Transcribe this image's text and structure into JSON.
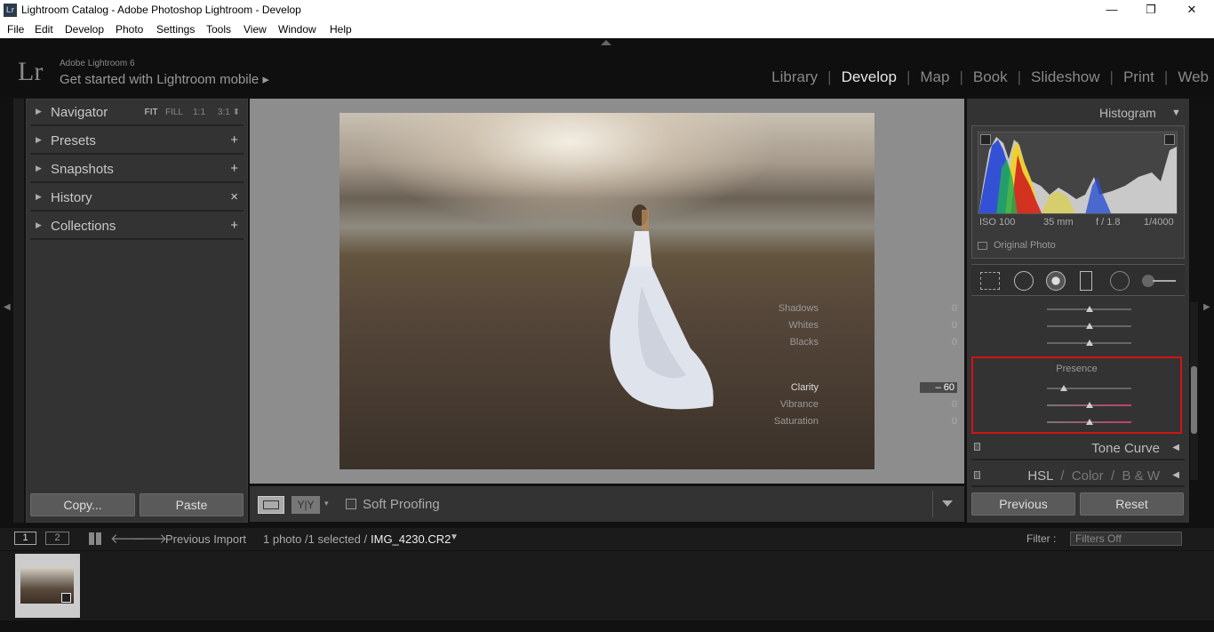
{
  "titlebar": {
    "title": "Lightroom Catalog - Adobe Photoshop Lightroom - Develop",
    "icon": "Lr",
    "minimize": "—",
    "restore": "❐",
    "close": "✕"
  },
  "menu": [
    "File",
    "Edit",
    "Develop",
    "Photo",
    "Settings",
    "Tools",
    "View",
    "Window",
    "Help"
  ],
  "identity": {
    "logo": "Lr",
    "product": "Adobe Lightroom 6",
    "tagline": "Get started with Lightroom mobile ▸"
  },
  "modules": [
    "Library",
    "Develop",
    "Map",
    "Book",
    "Slideshow",
    "Print",
    "Web"
  ],
  "active_module": "Develop",
  "left_panel": {
    "navigator": {
      "label": "Navigator",
      "options": {
        "fit": "FIT",
        "fill": "FILL",
        "one": "1:1",
        "three": "3:1"
      }
    },
    "presets": {
      "label": "Presets",
      "action": "+"
    },
    "snapshots": {
      "label": "Snapshots",
      "action": "+"
    },
    "history": {
      "label": "History",
      "action": "×"
    },
    "collections": {
      "label": "Collections",
      "action": "+"
    },
    "copy_button": "Copy...",
    "paste_button": "Paste"
  },
  "toolbar": {
    "soft_proofing": "Soft Proofing",
    "yy": "Y|Y"
  },
  "right_panel": {
    "histogram_title": "Histogram",
    "exif": {
      "iso": "ISO 100",
      "focal": "35 mm",
      "aperture": "f / 1.8",
      "shutter": "1/4000"
    },
    "original_photo": "Original Photo",
    "tone_sliders": [
      {
        "name": "Shadows",
        "value": "0",
        "pos": 0.5
      },
      {
        "name": "Whites",
        "value": "0",
        "pos": 0.5
      },
      {
        "name": "Blacks",
        "value": "0",
        "pos": 0.5
      }
    ],
    "presence": {
      "title": "Presence",
      "sliders": [
        {
          "name": "Clarity",
          "value": "– 60",
          "pos": 0.2
        },
        {
          "name": "Vibrance",
          "value": "0",
          "pos": 0.5
        },
        {
          "name": "Saturation",
          "value": "0",
          "pos": 0.5
        }
      ]
    },
    "tone_curve": "Tone Curve",
    "hsl": "HSL",
    "color": "Color",
    "bw": "B & W",
    "previous_button": "Previous",
    "reset_button": "Reset"
  },
  "filmstrip": {
    "page1": "1",
    "page2": "2",
    "source": "Previous Import",
    "info": "1 photo /1 selected /",
    "filename": "IMG_4230.CR2",
    "filter_label": "Filter :",
    "filter_value": "Filters Off"
  }
}
